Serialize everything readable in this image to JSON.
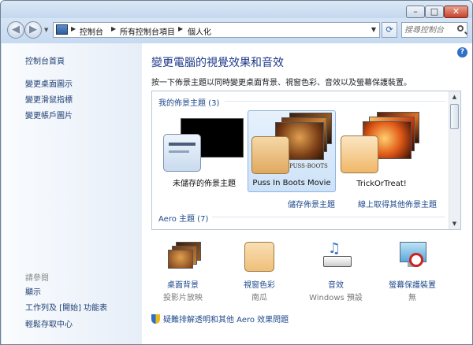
{
  "window": {
    "minimize_glyph": "–",
    "maximize_glyph": "□",
    "close_glyph": "✕"
  },
  "address": {
    "crumbs": [
      "控制台",
      "所有控制台項目",
      "個人化"
    ]
  },
  "search": {
    "placeholder": "搜尋控制台"
  },
  "sidebar": {
    "links": [
      "控制台首頁",
      "變更桌面圖示",
      "變更滑鼠指標",
      "變更帳戶圖片"
    ],
    "see_also_label": "請參閱",
    "see_also": [
      "顯示",
      "工作列及 [開始] 功能表",
      "輕鬆存取中心"
    ]
  },
  "main": {
    "title": "變更電腦的視覺效果和音效",
    "description": "按一下佈景主題以同時變更桌面背景、視窗色彩、音效以及螢幕保護裝置。",
    "my_themes_header": "我的佈景主題 (3)",
    "themes": [
      {
        "name": "未儲存的佈景主題",
        "selected": false
      },
      {
        "name": "Puss In Boots Movie",
        "selected": true
      },
      {
        "name": "TrickOrTreat!",
        "selected": false
      }
    ],
    "puss_logo": "PUSS-BOOTS",
    "save_theme": "儲存佈景主題",
    "get_more": "線上取得其他佈景主題",
    "aero_header": "Aero 主題 (7)"
  },
  "options": [
    {
      "link": "桌面背景",
      "value": "投影片放映",
      "icon": "desktop-background-icon"
    },
    {
      "link": "視窗色彩",
      "value": "南瓜",
      "icon": "window-color-icon"
    },
    {
      "link": "音效",
      "value": "Windows 預設",
      "icon": "sounds-icon"
    },
    {
      "link": "螢幕保護裝置",
      "value": "無",
      "icon": "screensaver-icon"
    }
  ],
  "troubleshoot_link": "疑難排解透明和其他 Aero 效果問題",
  "colors": {
    "accent": "#1e3a8a",
    "link": "#1f4a8c",
    "pumpkin": "#f2c98a"
  }
}
